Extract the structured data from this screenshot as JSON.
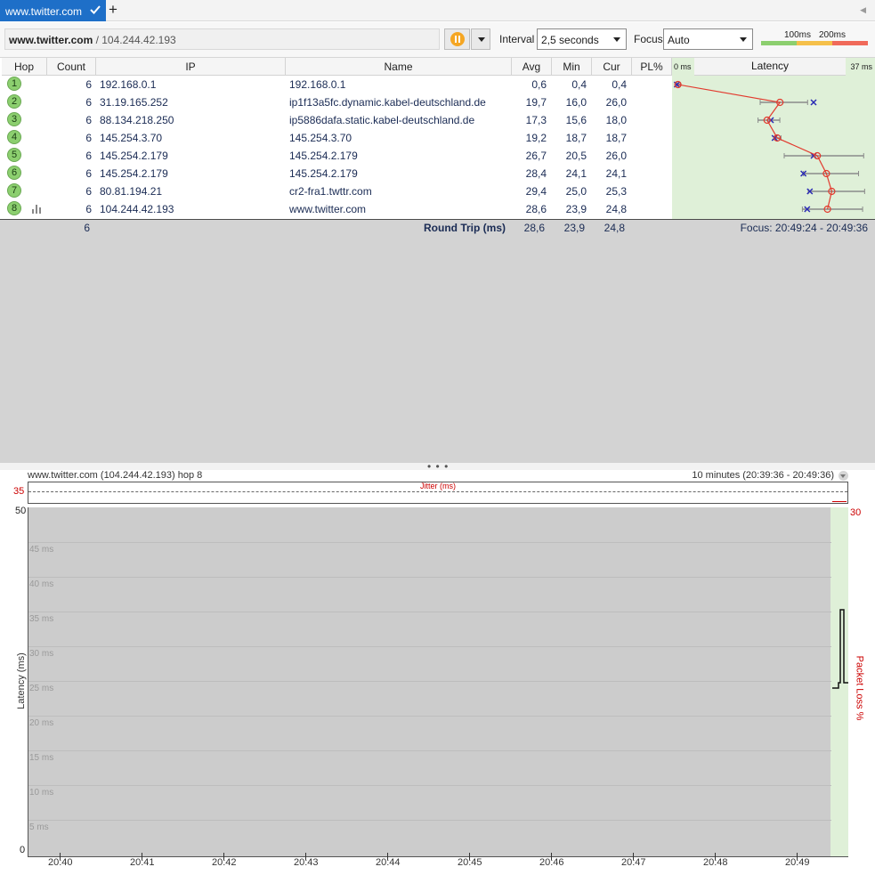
{
  "tabs": [
    {
      "label": "www.twitter.com",
      "active": true
    }
  ],
  "toolbar": {
    "target_host": "www.twitter.com",
    "target_ip": "/ 104.244.42.193",
    "interval_label": "Interval",
    "interval_value": "2,5 seconds",
    "focus_label": "Focus",
    "focus_value": "Auto",
    "scale_100": "100ms",
    "scale_200": "200ms",
    "scale_colors": [
      "#8ccf6f",
      "#f5c04a",
      "#f06a5a"
    ]
  },
  "columns": [
    "Hop",
    "Count",
    "IP",
    "Name",
    "Avg",
    "Min",
    "Cur",
    "PL%"
  ],
  "latency_header": {
    "title": "Latency",
    "min": "0 ms",
    "max": "37 ms"
  },
  "hops": [
    {
      "hop": "1",
      "count": "6",
      "ip": "192.168.0.1",
      "name": "192.168.0.1",
      "avg": "0,6",
      "min": "0,4",
      "cur": "0,4",
      "pl": ""
    },
    {
      "hop": "2",
      "count": "6",
      "ip": "31.19.165.252",
      "name": "ip1f13a5fc.dynamic.kabel-deutschland.de",
      "avg": "19,7",
      "min": "16,0",
      "cur": "26,0",
      "pl": ""
    },
    {
      "hop": "3",
      "count": "6",
      "ip": "88.134.218.250",
      "name": "ip5886dafa.static.kabel-deutschland.de",
      "avg": "17,3",
      "min": "15,6",
      "cur": "18,0",
      "pl": ""
    },
    {
      "hop": "4",
      "count": "6",
      "ip": "145.254.3.70",
      "name": "145.254.3.70",
      "avg": "19,2",
      "min": "18,7",
      "cur": "18,7",
      "pl": ""
    },
    {
      "hop": "5",
      "count": "6",
      "ip": "145.254.2.179",
      "name": "145.254.2.179",
      "avg": "26,7",
      "min": "20,5",
      "cur": "26,0",
      "pl": ""
    },
    {
      "hop": "6",
      "count": "6",
      "ip": "145.254.2.179",
      "name": "145.254.2.179",
      "avg": "28,4",
      "min": "24,1",
      "cur": "24,1",
      "pl": ""
    },
    {
      "hop": "7",
      "count": "6",
      "ip": "80.81.194.21",
      "name": "cr2-fra1.twttr.com",
      "avg": "29,4",
      "min": "25,0",
      "cur": "25,3",
      "pl": ""
    },
    {
      "hop": "8",
      "count": "6",
      "ip": "104.244.42.193",
      "name": "www.twitter.com",
      "avg": "28,6",
      "min": "23,9",
      "cur": "24,8",
      "pl": ""
    }
  ],
  "summary": {
    "count": "6",
    "label": "Round Trip (ms)",
    "avg": "28,6",
    "min": "23,9",
    "cur": "24,8",
    "focus": "Focus: 20:49:24 - 20:49:36"
  },
  "graph": {
    "title": "www.twitter.com (104.244.42.193) hop 8",
    "range": "10 minutes (20:39:36 - 20:49:36)",
    "jitter_label": "Jitter (ms)",
    "jitter_max": "35",
    "y_max": "50",
    "y_min": "0",
    "pl_max": "30",
    "y_title": "Latency (ms)",
    "pl_title": "Packet Loss %",
    "grid_labels": [
      "45 ms",
      "40 ms",
      "35 ms",
      "30 ms",
      "25 ms",
      "20 ms",
      "15 ms",
      "10 ms",
      "5 ms"
    ],
    "x_ticks": [
      "20:40",
      "20:41",
      "20:42",
      "20:43",
      "20:44",
      "20:45",
      "20:46",
      "20:47",
      "20:48",
      "20:49"
    ]
  }
}
